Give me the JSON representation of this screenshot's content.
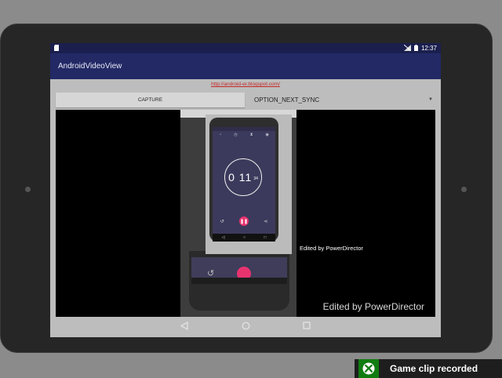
{
  "status_bar": {
    "time": "12:37"
  },
  "app_bar": {
    "title": "AndroidVideoView"
  },
  "content": {
    "link": "http://android-er.blogspot.com/",
    "capture_label": "CAPTURE",
    "spinner_value": "OPTION_NEXT_SYNC"
  },
  "video": {
    "stopwatch": {
      "main": "0 11",
      "sub": "34"
    },
    "caption_small": "Edited by PowerDirector",
    "caption_large": "Edited by PowerDirector"
  },
  "toast": {
    "text": "Game clip recorded"
  },
  "colors": {
    "app_bar": "#222965",
    "status_bar": "#1b1f4e",
    "accent": "#e8336f",
    "link": "#c62828",
    "xbox": "#107c10"
  },
  "icons": [
    "sd-card-icon",
    "no-signal-icon",
    "battery-icon",
    "back-icon",
    "home-icon",
    "recents-icon",
    "xbox-icon"
  ]
}
